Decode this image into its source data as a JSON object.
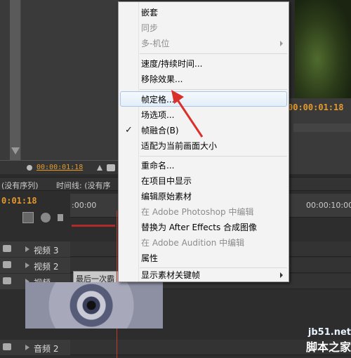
{
  "source": {
    "timecode": "00:00:01:18"
  },
  "program": {
    "timecode": "00:00:01:18"
  },
  "timeline": {
    "tabs": [
      "(没有序列)",
      "时间线: (没有序"
    ],
    "timecode": "0:01:18",
    "ruler": {
      "start": ":00:00",
      "end": "00:00:10:00"
    },
    "tracks": [
      "视频 3",
      "视频 2",
      "视频",
      "音频 2"
    ],
    "clip_label": "最后一次霸"
  },
  "menu": {
    "items": [
      {
        "label": "嵌套",
        "disabled": false
      },
      {
        "label": "同步",
        "disabled": true
      },
      {
        "label": "多-机位",
        "disabled": true,
        "submenu": true
      },
      {
        "label": "速度/持续时间...",
        "disabled": false
      },
      {
        "label": "移除效果...",
        "disabled": false
      },
      {
        "label": "帧定格...",
        "disabled": false,
        "highlight": true
      },
      {
        "label": "场选项...",
        "disabled": false
      },
      {
        "label": "帧融合(B)",
        "disabled": false,
        "checked": true
      },
      {
        "label": "适配为当前画面大小",
        "disabled": false
      },
      {
        "label": "重命名...",
        "disabled": false
      },
      {
        "label": "在项目中显示",
        "disabled": false
      },
      {
        "label": "编辑原始素材",
        "disabled": false
      },
      {
        "label": "在 Adobe Photoshop 中编辑",
        "disabled": true
      },
      {
        "label": "替换为 After Effects 合成图像",
        "disabled": false
      },
      {
        "label": "在 Adobe Audition 中编辑",
        "disabled": true
      },
      {
        "label": "属性",
        "disabled": false
      },
      {
        "label": "显示素材关键帧",
        "disabled": false,
        "submenu": true
      }
    ]
  },
  "watermark": {
    "site": "jb51.net",
    "name": "脚本之家"
  },
  "colors": {
    "timecode": "#e59a2c",
    "menu_highlight_border": "#a9c6e6",
    "pointer": "#d9302c"
  }
}
